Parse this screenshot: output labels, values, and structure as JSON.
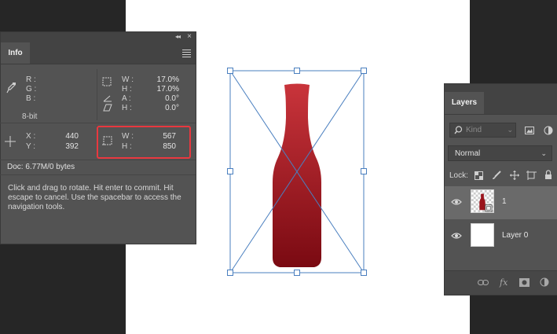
{
  "info_panel": {
    "tab_label": "Info",
    "color": {
      "r_label": "R :",
      "g_label": "G :",
      "b_label": "B :",
      "bit_depth": "8-bit"
    },
    "transform": {
      "w_label": "W :",
      "w_value": "17.0%",
      "h_label": "H :",
      "h_value": "17.0%",
      "a_label": "A :",
      "a_value": "0.0°",
      "skew_h_label": "H :",
      "skew_h_value": "0.0°"
    },
    "position": {
      "x_label": "X :",
      "x_value": "440",
      "y_label": "Y :",
      "y_value": "392"
    },
    "size": {
      "w_label": "W :",
      "w_value": "567",
      "h_label": "H :",
      "h_value": "850"
    },
    "doc_info": "Doc: 6.77M/0 bytes",
    "help_text_lines": [
      "Click and drag to rotate. Hit enter to commit. Hit",
      "escape to cancel. Use the spacebar to access the",
      "navigation tools."
    ],
    "highlight_color": "#e8383f"
  },
  "layers_panel": {
    "tab_label": "Layers",
    "filter_placeholder": "Kind",
    "blend_mode": "Normal",
    "lock_label": "Lock:",
    "layers": [
      {
        "name": "1",
        "selected": true
      },
      {
        "name": "Layer 0",
        "selected": false
      }
    ],
    "footer_icons": [
      "link-icon",
      "fx-icon",
      "mask-icon",
      "adjustment-icon"
    ]
  },
  "colors": {
    "panel_bg": "#535353",
    "canvas_bg": "#262626",
    "bottle_top": "#c8323a",
    "bottle_bottom": "#7a0a12",
    "transform_line": "#4a7fbf"
  }
}
